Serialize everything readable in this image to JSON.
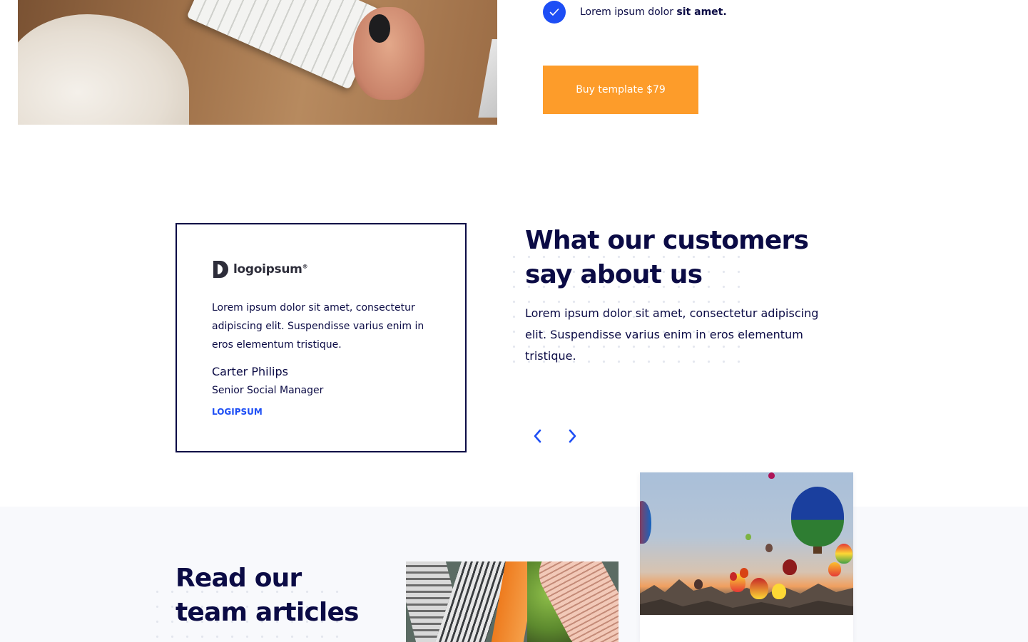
{
  "hero": {
    "feature_text_prefix": "Lorem ipsum dolor ",
    "feature_text_bold": "sit amet.",
    "buy_button_label": "Buy template $79"
  },
  "testimonials": {
    "title_line1": "What our customers",
    "title_line2": "say about us",
    "subtitle": "Lorem ipsum dolor sit amet, consectetur adipiscing elit. Suspendisse varius enim in eros elementum tristique.",
    "card": {
      "logo_text": "logoipsum",
      "logo_mark": "®",
      "quote": "Lorem ipsum dolor sit amet, consectetur adipiscing elit. Suspendisse varius enim in eros elementum tristique.",
      "author_name": "Carter Philips",
      "author_role": "Senior Social Manager",
      "author_company": "LOGIPSUM"
    },
    "prev_icon": "chevron-left-icon",
    "next_icon": "chevron-right-icon"
  },
  "articles": {
    "title_line1": "Read our",
    "title_line2": "team articles"
  },
  "colors": {
    "navy": "#0b0b45",
    "accent_blue": "#1d4ef5",
    "orange": "#fd9c2a",
    "section_bg": "#f8f9fc"
  }
}
